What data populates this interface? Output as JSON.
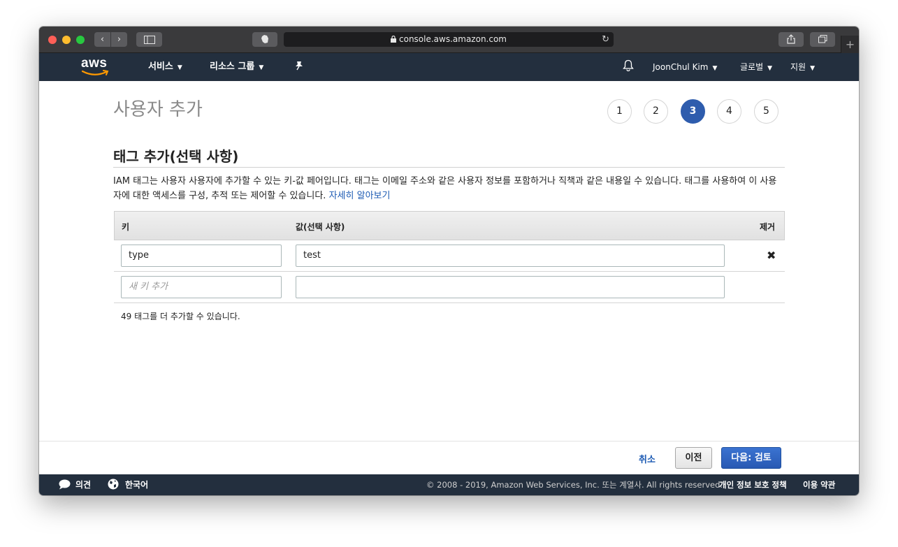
{
  "browser": {
    "url": "console.aws.amazon.com",
    "icons": [
      "chevron-left-icon",
      "chevron-right-icon",
      "sidebar-icon",
      "evernote-icon",
      "lock-icon",
      "reload-icon",
      "share-icon",
      "tabs-icon",
      "plus-icon"
    ]
  },
  "aws_nav": {
    "logo_text": "aws",
    "services": "서비스",
    "resource_groups": "리소스 그룹",
    "user": "JoonChul Kim",
    "region": "글로벌",
    "support": "지원"
  },
  "page": {
    "title": "사용자 추가",
    "steps": [
      "1",
      "2",
      "3",
      "4",
      "5"
    ],
    "active_step": "3",
    "section_title": "태그 추가(선택 사항)",
    "description": "IAM 태그는 사용자 사용자에 추가할 수 있는 키-값 페어입니다. 태그는 이메일 주소와 같은 사용자 정보를 포함하거나 직책과 같은 내용일 수 있습니다. 태그를 사용하여 이 사용자에 대한 액세스를 구성, 추적 또는 제어할 수 있습니다.",
    "learn_more": "자세히 알아보기"
  },
  "tags_table": {
    "headers": {
      "key": "키",
      "value": "값(선택 사항)",
      "remove": "제거"
    },
    "rows": [
      {
        "key": "type",
        "value": "test"
      }
    ],
    "new_row": {
      "key_placeholder": "새 키 추가",
      "value": ""
    },
    "remaining": "49 태그를 더 추가할 수 있습니다."
  },
  "actions": {
    "cancel": "취소",
    "previous": "이전",
    "next": "다음: 검토"
  },
  "footer": {
    "feedback": "의견",
    "language": "한국어",
    "copyright": "© 2008 - 2019, Amazon Web Services, Inc. 또는 계열사. All rights reserved.",
    "privacy": "개인 정보 보호 정책",
    "terms": "이용 약관"
  },
  "colors": {
    "nav_bg": "#232f3e",
    "active_step": "#2e5cad",
    "primary_button": "#2f63bf",
    "link": "#1c5ab3"
  }
}
